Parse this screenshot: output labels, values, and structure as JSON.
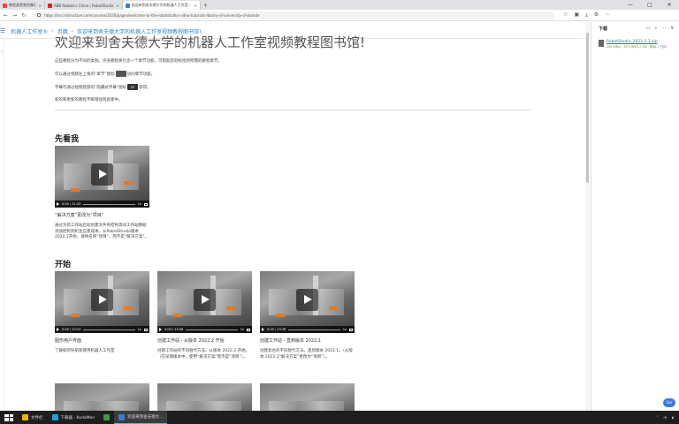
{
  "browser": {
    "tabs": [
      {
        "label": "教程类视频合集2",
        "color": "#e44"
      },
      {
        "label": "ABB Robotics China | RobotStudio",
        "color": "#d22"
      },
      {
        "label": "欢迎来到舍夫德大学的机器人工作室...",
        "color": "#3a7bd5",
        "active": true
      }
    ],
    "new_tab": "+",
    "url": "https://his.instructure.com/courses/3326/pages/welcome-to-the-robotstudio-video-tutorials-library-of-university-of-skovde",
    "win_controls": [
      "—",
      "□",
      "✕"
    ]
  },
  "breadcrumb": {
    "items": [
      "机器人工作室®",
      "页面",
      "欢迎来到舍夫德大学的机器人工作室视频教程图书馆!"
    ]
  },
  "leftbar": {
    "arrow": "›"
  },
  "main": {
    "title": "欢迎来到舍夫德大学的机器人工作室视频教程图书馆!",
    "p1": "这些教程分为不同的类别。许多教程将包含一个章节功能，可帮助您轻松找到所需的教程章节。",
    "p2a": "可以通过视频左上角的“章节”图标",
    "p2b": "访问章节功能。",
    "p3a": "字幕可通过视频底部的“隐藏式字幕”图标",
    "p3b": "获得。",
    "p3icon": "cc",
    "p4": "新的和更新的教程不断增加到此库中。"
  },
  "sections": {
    "first": "先看我",
    "start": "开始"
  },
  "cards": [
    {
      "time": "0:00 / 11:43",
      "title": "“解决方案”更改为“项目”",
      "desc": "通过为新工作站启动创建文件夹结构等同工作站数据添加结构到机生应建成本。从RobotStudio版本2022.2开始，请将名称“项目”，而不是“解决方案”。"
    },
    {
      "time": "0:00 / 13:23",
      "title": "图形用户界面",
      "desc": "了解如何导航和使用机器人工作室"
    },
    {
      "time": "0:00 / 14:58",
      "title": "创建工作站 - 从版本 2022.2 开始",
      "desc": "创建工作站的不同替代方法。从版本 2022.2 开始。（在早期版本中，使用“解决方案”而不是“项目”）。"
    },
    {
      "time": "0:00 / 13:36",
      "title": "创建工作站 - 直到版本 2022.1",
      "desc": "创建具台的不同替代方法。直到版本 2022.1。（从版本 2022.2“解决方案”更改为“项目”）。"
    }
  ],
  "video_controls": {
    "speed": "1x"
  },
  "downloads": {
    "title": "下载",
    "file_name": "RobotStudio_2022.2.1.zip",
    "file_meta": "280 MB/s · 873 MB/2.2 GB · 剩余 1 分钟",
    "badge": "Sar"
  },
  "taskbar": {
    "items": [
      {
        "label": "文件栏",
        "color": "#f0b400"
      },
      {
        "label": "下载器 - KodaMen",
        "color": "#1aa0e0"
      },
      {
        "label": "",
        "color": "#3c9a3c"
      },
      {
        "label": "欢迎来到舍夫德大...",
        "color": "#3a7bd5",
        "active": true
      }
    ]
  }
}
